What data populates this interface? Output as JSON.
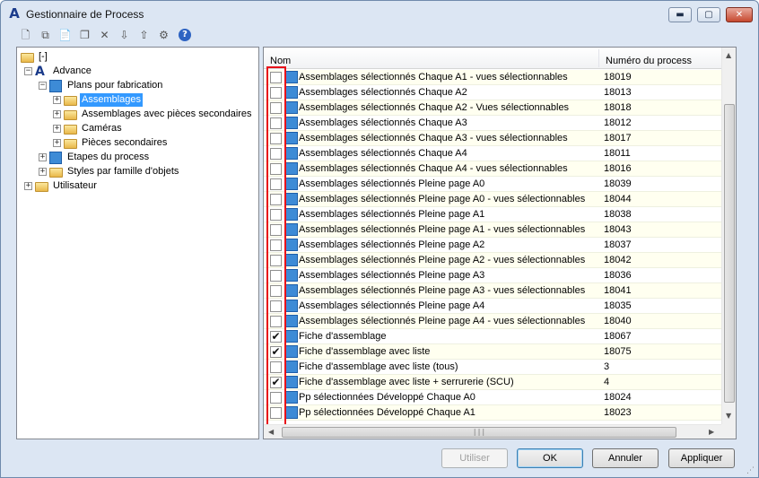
{
  "window": {
    "title": "Gestionnaire de Process",
    "app_icon": "A",
    "minimize_glyph": "▬",
    "maximize_glyph": "▢",
    "close_glyph": "✕"
  },
  "toolbar": {
    "icons": [
      {
        "name": "new-icon",
        "glyph": "🗋"
      },
      {
        "name": "copy-icon",
        "glyph": "⧉"
      },
      {
        "name": "paste-icon",
        "glyph": "📄"
      },
      {
        "name": "duplicate-icon",
        "glyph": "❐"
      },
      {
        "name": "delete-icon",
        "glyph": "✕"
      },
      {
        "name": "import-icon",
        "glyph": "⇩"
      },
      {
        "name": "export-icon",
        "glyph": "⇧"
      },
      {
        "name": "settings-icon",
        "glyph": "⚙"
      },
      {
        "name": "help-icon",
        "glyph": "?"
      }
    ]
  },
  "tree": {
    "nodes": [
      {
        "label": "[-]",
        "level": 0,
        "expander": "",
        "icon": "folder"
      },
      {
        "label": "Advance",
        "level": 1,
        "expander": "−",
        "icon": "a"
      },
      {
        "label": "Plans pour fabrication",
        "level": 2,
        "expander": "−",
        "icon": "blue"
      },
      {
        "label": "Assemblages",
        "level": 3,
        "expander": "+",
        "icon": "folder",
        "selected": true
      },
      {
        "label": "Assemblages avec pièces secondaires",
        "level": 3,
        "expander": "+",
        "icon": "folder"
      },
      {
        "label": "Caméras",
        "level": 3,
        "expander": "+",
        "icon": "folder"
      },
      {
        "label": "Pièces secondaires",
        "level": 3,
        "expander": "+",
        "icon": "folder"
      },
      {
        "label": "Etapes du process",
        "level": 2,
        "expander": "+",
        "icon": "blue-pen"
      },
      {
        "label": "Styles par famille d'objets",
        "level": 2,
        "expander": "+",
        "icon": "folder"
      },
      {
        "label": "Utilisateur",
        "level": 1,
        "expander": "+",
        "icon": "folder"
      }
    ]
  },
  "grid": {
    "columns": {
      "name": "Nom",
      "number": "Numéro du process"
    },
    "rows": [
      {
        "name": "Assemblages sélectionnés Chaque A1 - vues sélectionnables",
        "number": "18019",
        "checked": false
      },
      {
        "name": "Assemblages sélectionnés Chaque A2",
        "number": "18013",
        "checked": false
      },
      {
        "name": "Assemblages sélectionnés Chaque A2 - Vues sélectionnables",
        "number": "18018",
        "checked": false
      },
      {
        "name": "Assemblages sélectionnés Chaque A3",
        "number": "18012",
        "checked": false
      },
      {
        "name": "Assemblages sélectionnés Chaque A3 - vues sélectionnables",
        "number": "18017",
        "checked": false
      },
      {
        "name": "Assemblages sélectionnés Chaque A4",
        "number": "18011",
        "checked": false
      },
      {
        "name": "Assemblages sélectionnés Chaque A4 - vues sélectionnables",
        "number": "18016",
        "checked": false
      },
      {
        "name": "Assemblages sélectionnés Pleine page A0",
        "number": "18039",
        "checked": false
      },
      {
        "name": "Assemblages sélectionnés Pleine page A0 - vues sélectionnables",
        "number": "18044",
        "checked": false
      },
      {
        "name": "Assemblages sélectionnés Pleine page A1",
        "number": "18038",
        "checked": false
      },
      {
        "name": "Assemblages sélectionnés Pleine page A1 - vues sélectionnables",
        "number": "18043",
        "checked": false
      },
      {
        "name": "Assemblages sélectionnés Pleine page A2",
        "number": "18037",
        "checked": false
      },
      {
        "name": "Assemblages sélectionnés Pleine page A2  - vues sélectionnables",
        "number": "18042",
        "checked": false
      },
      {
        "name": "Assemblages sélectionnés Pleine page A3",
        "number": "18036",
        "checked": false
      },
      {
        "name": "Assemblages sélectionnés Pleine page A3 - vues sélectionnables",
        "number": "18041",
        "checked": false
      },
      {
        "name": "Assemblages sélectionnés Pleine page A4",
        "number": "18035",
        "checked": false
      },
      {
        "name": "Assemblages sélectionnés Pleine page A4 - vues sélectionnables",
        "number": "18040",
        "checked": false
      },
      {
        "name": "Fiche d'assemblage",
        "number": "18067",
        "checked": true
      },
      {
        "name": "Fiche d'assemblage avec liste",
        "number": "18075",
        "checked": true
      },
      {
        "name": "Fiche d'assemblage avec liste (tous)",
        "number": "3",
        "checked": false
      },
      {
        "name": "Fiche d'assemblage avec liste + serrurerie (SCU)",
        "number": "4",
        "checked": true
      },
      {
        "name": "Pp sélectionnées Développé Chaque A0",
        "number": "18024",
        "checked": false
      },
      {
        "name": "Pp sélectionnées Développé Chaque A1",
        "number": "18023",
        "checked": false
      }
    ],
    "check_glyph": "✔",
    "scroll_up_glyph": "▲",
    "scroll_down_glyph": "▼",
    "scroll_left_glyph": "◀",
    "scroll_right_glyph": "▶",
    "hthumb_grip": "|||"
  },
  "buttons": {
    "use": "Utiliser",
    "ok": "OK",
    "cancel": "Annuler",
    "apply": "Appliquer"
  },
  "colors": {
    "selection": "#3399ff",
    "highlight_border": "#e8101a",
    "window_frame": "#dce6f3"
  }
}
